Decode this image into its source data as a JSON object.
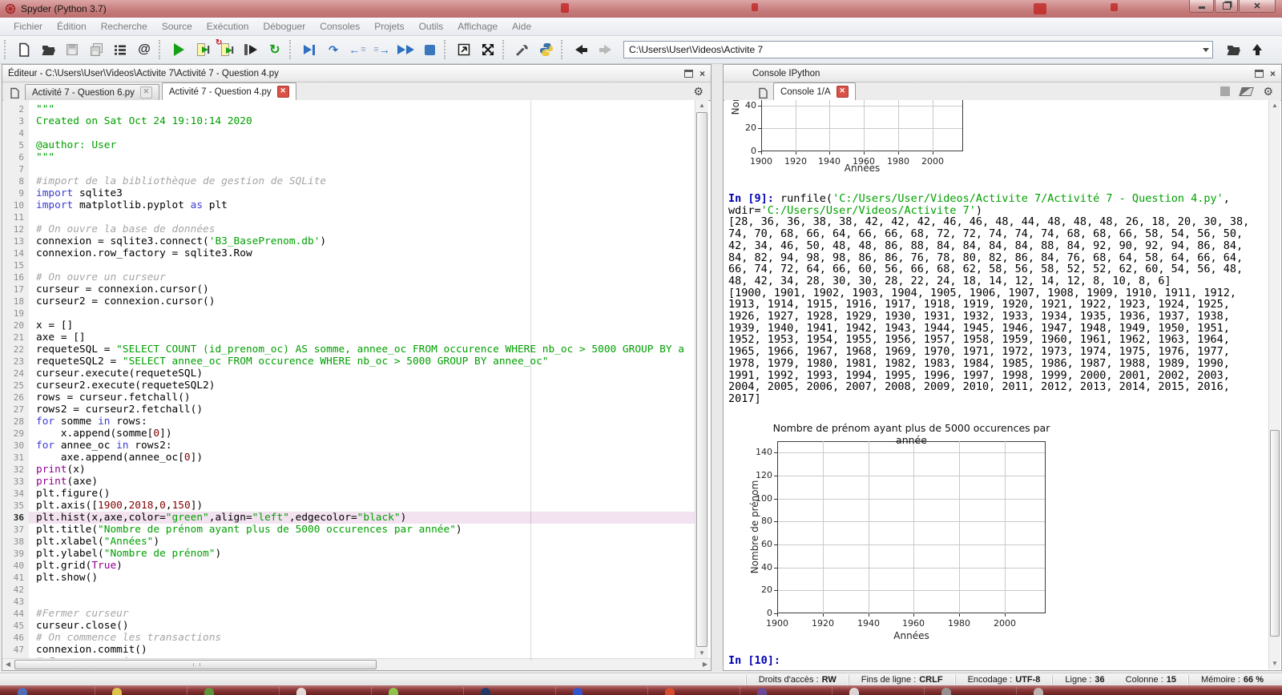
{
  "window": {
    "title": "Spyder (Python 3.7)"
  },
  "menu": {
    "items": [
      "Fichier",
      "Édition",
      "Recherche",
      "Source",
      "Exécution",
      "Déboguer",
      "Consoles",
      "Projets",
      "Outils",
      "Affichage",
      "Aide"
    ]
  },
  "toolbar": {
    "path_value": "C:\\Users\\User\\Videos\\Activite 7"
  },
  "editor": {
    "pane_title": "Éditeur - C:\\Users\\User\\Videos\\Activite 7\\Activité 7 - Question 4.py",
    "tabs": [
      {
        "label": "Activité 7 - Question 6.py",
        "active": false
      },
      {
        "label": "Activité 7 - Question 4.py",
        "active": true
      }
    ],
    "lines": [
      {
        "n": 2,
        "seg": [
          [
            "s",
            "\"\"\""
          ]
        ]
      },
      {
        "n": 3,
        "seg": [
          [
            "s",
            "Created on Sat Oct 24 19:10:14 2020"
          ]
        ]
      },
      {
        "n": 4,
        "seg": []
      },
      {
        "n": 5,
        "seg": [
          [
            "s",
            "@author: User"
          ]
        ]
      },
      {
        "n": 6,
        "seg": [
          [
            "s",
            "\"\"\""
          ]
        ]
      },
      {
        "n": 7,
        "seg": []
      },
      {
        "n": 8,
        "seg": [
          [
            "c",
            "#import de la bibliothèque de gestion de SQLite"
          ]
        ]
      },
      {
        "n": 9,
        "seg": [
          [
            "k",
            "import"
          ],
          [
            "p",
            " sqlite3"
          ]
        ]
      },
      {
        "n": 10,
        "seg": [
          [
            "k",
            "import"
          ],
          [
            "p",
            " matplotlib.pyplot "
          ],
          [
            "k",
            "as"
          ],
          [
            "p",
            " plt"
          ]
        ]
      },
      {
        "n": 11,
        "seg": []
      },
      {
        "n": 12,
        "seg": [
          [
            "c",
            "# On ouvre la base de données"
          ]
        ]
      },
      {
        "n": 13,
        "seg": [
          [
            "p",
            "connexion = sqlite3.connect("
          ],
          [
            "s",
            "'B3_BasePrenom.db'"
          ],
          [
            "p",
            ")"
          ]
        ]
      },
      {
        "n": 14,
        "seg": [
          [
            "p",
            "connexion.row_factory = sqlite3.Row"
          ]
        ]
      },
      {
        "n": 15,
        "seg": []
      },
      {
        "n": 16,
        "seg": [
          [
            "c",
            "# On ouvre un curseur"
          ]
        ]
      },
      {
        "n": 17,
        "seg": [
          [
            "p",
            "curseur = connexion.cursor()"
          ]
        ]
      },
      {
        "n": 18,
        "seg": [
          [
            "p",
            "curseur2 = connexion.cursor()"
          ]
        ]
      },
      {
        "n": 19,
        "seg": []
      },
      {
        "n": 20,
        "seg": [
          [
            "p",
            "x = []"
          ]
        ]
      },
      {
        "n": 21,
        "seg": [
          [
            "p",
            "axe = []"
          ]
        ]
      },
      {
        "n": 22,
        "seg": [
          [
            "p",
            "requeteSQL = "
          ],
          [
            "s",
            "\"SELECT COUNT (id_prenom_oc) AS somme, annee_oc FROM occurence WHERE nb_oc > 5000 GROUP BY a"
          ]
        ]
      },
      {
        "n": 23,
        "seg": [
          [
            "p",
            "requeteSQL2 = "
          ],
          [
            "s",
            "\"SELECT annee_oc FROM occurence WHERE nb_oc > 5000 GROUP BY annee_oc\""
          ]
        ]
      },
      {
        "n": 24,
        "seg": [
          [
            "p",
            "curseur.execute(requeteSQL)"
          ]
        ]
      },
      {
        "n": 25,
        "seg": [
          [
            "p",
            "curseur2.execute(requeteSQL2)"
          ]
        ]
      },
      {
        "n": 26,
        "seg": [
          [
            "p",
            "rows = curseur.fetchall()"
          ]
        ]
      },
      {
        "n": 27,
        "seg": [
          [
            "p",
            "rows2 = curseur2.fetchall()"
          ]
        ]
      },
      {
        "n": 28,
        "seg": [
          [
            "k",
            "for"
          ],
          [
            "p",
            " somme "
          ],
          [
            "k",
            "in"
          ],
          [
            "p",
            " rows:"
          ]
        ]
      },
      {
        "n": 29,
        "seg": [
          [
            "p",
            "    x.append(somme["
          ],
          [
            "d",
            "0"
          ],
          [
            "p",
            "])"
          ]
        ]
      },
      {
        "n": 30,
        "seg": [
          [
            "k",
            "for"
          ],
          [
            "p",
            " annee_oc "
          ],
          [
            "k",
            "in"
          ],
          [
            "p",
            " rows2:"
          ]
        ]
      },
      {
        "n": 31,
        "seg": [
          [
            "p",
            "    axe.append(annee_oc["
          ],
          [
            "d",
            "0"
          ],
          [
            "p",
            "])"
          ]
        ]
      },
      {
        "n": 32,
        "seg": [
          [
            "b",
            "print"
          ],
          [
            "p",
            "(x)"
          ]
        ]
      },
      {
        "n": 33,
        "seg": [
          [
            "b",
            "print"
          ],
          [
            "p",
            "(axe)"
          ]
        ]
      },
      {
        "n": 34,
        "seg": [
          [
            "p",
            "plt.figure()"
          ]
        ]
      },
      {
        "n": 35,
        "seg": [
          [
            "p",
            "plt.axis(["
          ],
          [
            "d",
            "1900"
          ],
          [
            "p",
            ","
          ],
          [
            "d",
            "2018"
          ],
          [
            "p",
            ","
          ],
          [
            "d",
            "0"
          ],
          [
            "p",
            ","
          ],
          [
            "d",
            "150"
          ],
          [
            "p",
            "])"
          ]
        ]
      },
      {
        "n": 36,
        "hl": true,
        "seg": [
          [
            "p",
            "plt.hist(x,axe,color="
          ],
          [
            "s",
            "\"green\""
          ],
          [
            "p",
            ",align="
          ],
          [
            "s",
            "\"left\""
          ],
          [
            "p",
            ",edgecolor="
          ],
          [
            "s",
            "\"black\""
          ],
          [
            "p",
            ")"
          ]
        ]
      },
      {
        "n": 37,
        "seg": [
          [
            "p",
            "plt.title("
          ],
          [
            "s",
            "\"Nombre de prénom ayant plus de 5000 occurences par année\""
          ],
          [
            "p",
            ")"
          ]
        ]
      },
      {
        "n": 38,
        "seg": [
          [
            "p",
            "plt.xlabel("
          ],
          [
            "s",
            "\"Années\""
          ],
          [
            "p",
            ")"
          ]
        ]
      },
      {
        "n": 39,
        "seg": [
          [
            "p",
            "plt.ylabel("
          ],
          [
            "s",
            "\"Nombre de prénom\""
          ],
          [
            "p",
            ")"
          ]
        ]
      },
      {
        "n": 40,
        "seg": [
          [
            "p",
            "plt.grid("
          ],
          [
            "b",
            "True"
          ],
          [
            "p",
            ")"
          ]
        ]
      },
      {
        "n": 41,
        "seg": [
          [
            "p",
            "plt.show()"
          ]
        ]
      },
      {
        "n": 42,
        "seg": []
      },
      {
        "n": 43,
        "seg": []
      },
      {
        "n": 44,
        "seg": [
          [
            "c",
            "#Fermer curseur"
          ]
        ]
      },
      {
        "n": 45,
        "seg": [
          [
            "p",
            "curseur.close()"
          ]
        ]
      },
      {
        "n": 46,
        "seg": [
          [
            "c",
            "# On commence les transactions"
          ]
        ]
      },
      {
        "n": 47,
        "seg": [
          [
            "p",
            "connexion.commit()"
          ]
        ]
      },
      {
        "n": 48,
        "seg": [
          [
            "c",
            "# Ferme connexion"
          ]
        ]
      }
    ]
  },
  "console": {
    "pane_title": "Console IPython",
    "tab_label": "Console 1/A",
    "lines": [
      [
        [
          "pr",
          "In [9]: "
        ],
        [
          "p",
          "runfile("
        ],
        [
          "s",
          "'C:/Users/User/Videos/Activite 7/Activité 7 - Question 4.py'"
        ],
        [
          "p",
          ","
        ]
      ],
      [
        [
          "p",
          "wdir="
        ],
        [
          "s",
          "'C:/Users/User/Videos/Activite 7'"
        ],
        [
          "p",
          ")"
        ]
      ],
      [
        [
          "p",
          "[28, 36, 36, 38, 38, 42, 42, 42, 46, 46, 48, 44, 48, 48, 48, 26, 18, 20, 30, 38,"
        ]
      ],
      [
        [
          "p",
          "74, 70, 68, 66, 64, 66, 66, 68, 72, 72, 74, 74, 74, 68, 68, 66, 58, 54, 56, 50,"
        ]
      ],
      [
        [
          "p",
          "42, 34, 46, 50, 48, 48, 86, 88, 84, 84, 84, 84, 88, 84, 92, 90, 92, 94, 86, 84,"
        ]
      ],
      [
        [
          "p",
          "84, 82, 94, 98, 98, 86, 86, 76, 78, 80, 82, 86, 84, 76, 68, 64, 58, 64, 66, 64,"
        ]
      ],
      [
        [
          "p",
          "66, 74, 72, 64, 66, 60, 56, 66, 68, 62, 58, 56, 58, 52, 52, 62, 60, 54, 56, 48,"
        ]
      ],
      [
        [
          "p",
          "48, 42, 34, 28, 30, 30, 28, 22, 24, 18, 14, 12, 14, 12, 8, 10, 8, 6]"
        ]
      ],
      [
        [
          "p",
          "[1900, 1901, 1902, 1903, 1904, 1905, 1906, 1907, 1908, 1909, 1910, 1911, 1912,"
        ]
      ],
      [
        [
          "p",
          "1913, 1914, 1915, 1916, 1917, 1918, 1919, 1920, 1921, 1922, 1923, 1924, 1925,"
        ]
      ],
      [
        [
          "p",
          "1926, 1927, 1928, 1929, 1930, 1931, 1932, 1933, 1934, 1935, 1936, 1937, 1938,"
        ]
      ],
      [
        [
          "p",
          "1939, 1940, 1941, 1942, 1943, 1944, 1945, 1946, 1947, 1948, 1949, 1950, 1951,"
        ]
      ],
      [
        [
          "p",
          "1952, 1953, 1954, 1955, 1956, 1957, 1958, 1959, 1960, 1961, 1962, 1963, 1964,"
        ]
      ],
      [
        [
          "p",
          "1965, 1966, 1967, 1968, 1969, 1970, 1971, 1972, 1973, 1974, 1975, 1976, 1977,"
        ]
      ],
      [
        [
          "p",
          "1978, 1979, 1980, 1981, 1982, 1983, 1984, 1985, 1986, 1987, 1988, 1989, 1990,"
        ]
      ],
      [
        [
          "p",
          "1991, 1992, 1993, 1994, 1995, 1996, 1997, 1998, 1999, 2000, 2001, 2002, 2003,"
        ]
      ],
      [
        [
          "p",
          "2004, 2005, 2006, 2007, 2008, 2009, 2010, 2011, 2012, 2013, 2014, 2015, 2016,"
        ]
      ],
      [
        [
          "p",
          "2017]"
        ]
      ]
    ],
    "prompt_next": "In [10]:"
  },
  "statusbar": {
    "sections": [
      {
        "items": [
          {
            "label": "Droits d'accès :",
            "value": "RW"
          }
        ]
      },
      {
        "items": [
          {
            "label": "Fins de ligne :",
            "value": "CRLF"
          }
        ]
      },
      {
        "items": [
          {
            "label": "Encodage :",
            "value": "UTF-8"
          }
        ]
      },
      {
        "items": [
          {
            "label": "Ligne :",
            "value": "36"
          },
          {
            "label": "Colonne :",
            "value": "15"
          }
        ]
      },
      {
        "items": [
          {
            "label": "Mémoire :",
            "value": "66 %"
          }
        ]
      }
    ]
  },
  "taskbar": {
    "icon_colors": [
      "#4a76c8",
      "#e8d44d",
      "#5a9e3a",
      "#f0ede8",
      "#8fd14f",
      "#1a3a6b",
      "#2a5adf",
      "#e05030",
      "#6a4a9e",
      "#e8e8e8",
      "#9a9a9a",
      "#c4c0bc"
    ]
  },
  "chart_data": [
    {
      "type": "bar",
      "note": "partially visible figure, empty axes, no bars drawn",
      "title": "",
      "xlabel": "Années",
      "ylabel": "Nombre de prénom",
      "xlim": [
        1900,
        2018
      ],
      "ylim": [
        0,
        150
      ],
      "x_ticks": [
        1900,
        1920,
        1940,
        1960,
        1980,
        2000
      ],
      "y_ticks": [
        0,
        20,
        40
      ],
      "grid": true,
      "values": []
    },
    {
      "type": "bar",
      "note": "empty axes, no bars drawn",
      "title": "Nombre de prénom ayant plus de 5000 occurences par année",
      "xlabel": "Années",
      "ylabel": "Nombre de prénom",
      "xlim": [
        1900,
        2018
      ],
      "ylim": [
        0,
        150
      ],
      "x_ticks": [
        1900,
        1920,
        1940,
        1960,
        1980,
        2000
      ],
      "y_ticks": [
        0,
        20,
        40,
        60,
        80,
        100,
        120,
        140
      ],
      "grid": true,
      "values": []
    }
  ]
}
